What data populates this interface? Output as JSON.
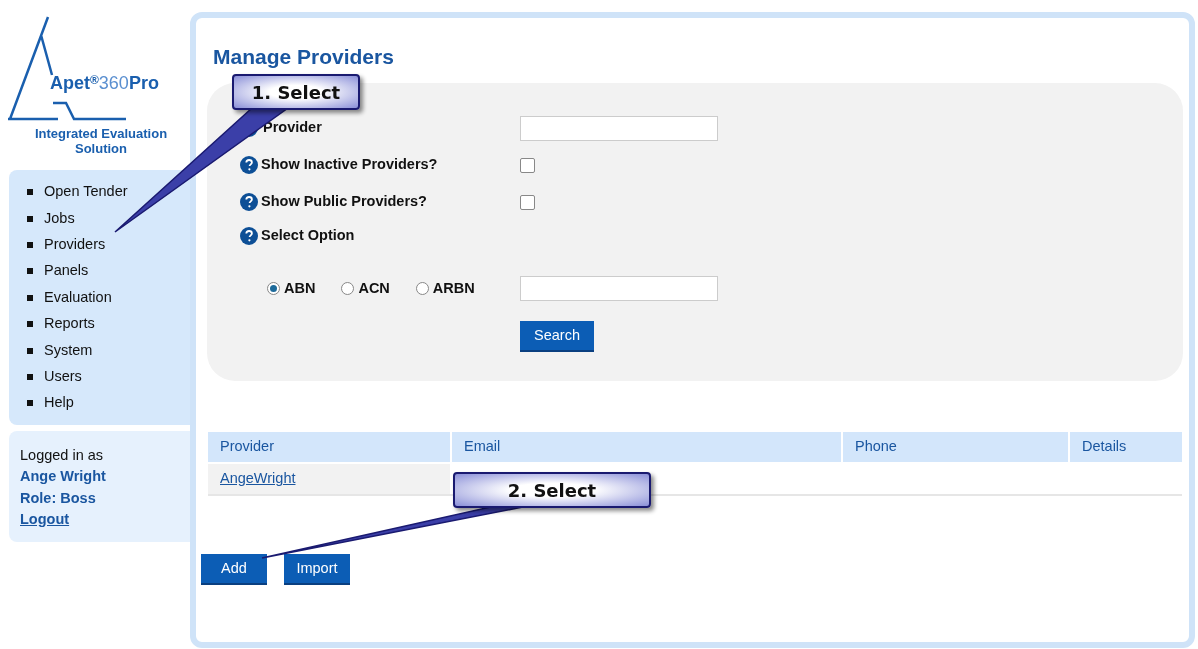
{
  "logo": {
    "name": "Apet",
    "reg": "®",
    "number": "360",
    "suffix": "Pro",
    "tagline": "Integrated Evaluation Solution"
  },
  "nav": [
    {
      "label": "Open Tender"
    },
    {
      "label": "Jobs"
    },
    {
      "label": "Providers"
    },
    {
      "label": "Panels"
    },
    {
      "label": "Evaluation"
    },
    {
      "label": "Reports"
    },
    {
      "label": "System"
    },
    {
      "label": "Users"
    },
    {
      "label": "Help"
    }
  ],
  "login": {
    "caption": "Logged in as",
    "user": "Ange Wright",
    "role": "Role: Boss",
    "logout": "Logout"
  },
  "title": "Manage Providers",
  "form": {
    "provider_label": "Provider",
    "checks": [
      {
        "label": "Show Inactive Providers?",
        "checked": false
      },
      {
        "label": "Show Public Providers?",
        "checked": false
      }
    ],
    "option_label": "Select Option",
    "options": [
      {
        "label": "ABN",
        "selected": true
      },
      {
        "label": "ACN",
        "selected": false
      },
      {
        "label": "ARBN",
        "selected": false
      }
    ],
    "search": "Search"
  },
  "table": {
    "columns": [
      "Provider",
      "Email",
      "Phone",
      "Details"
    ],
    "rows": [
      [
        "AngeWright"
      ]
    ]
  },
  "buttons": [
    "Add",
    "Import"
  ],
  "callouts": [
    "1. Select",
    "2. Select"
  ]
}
